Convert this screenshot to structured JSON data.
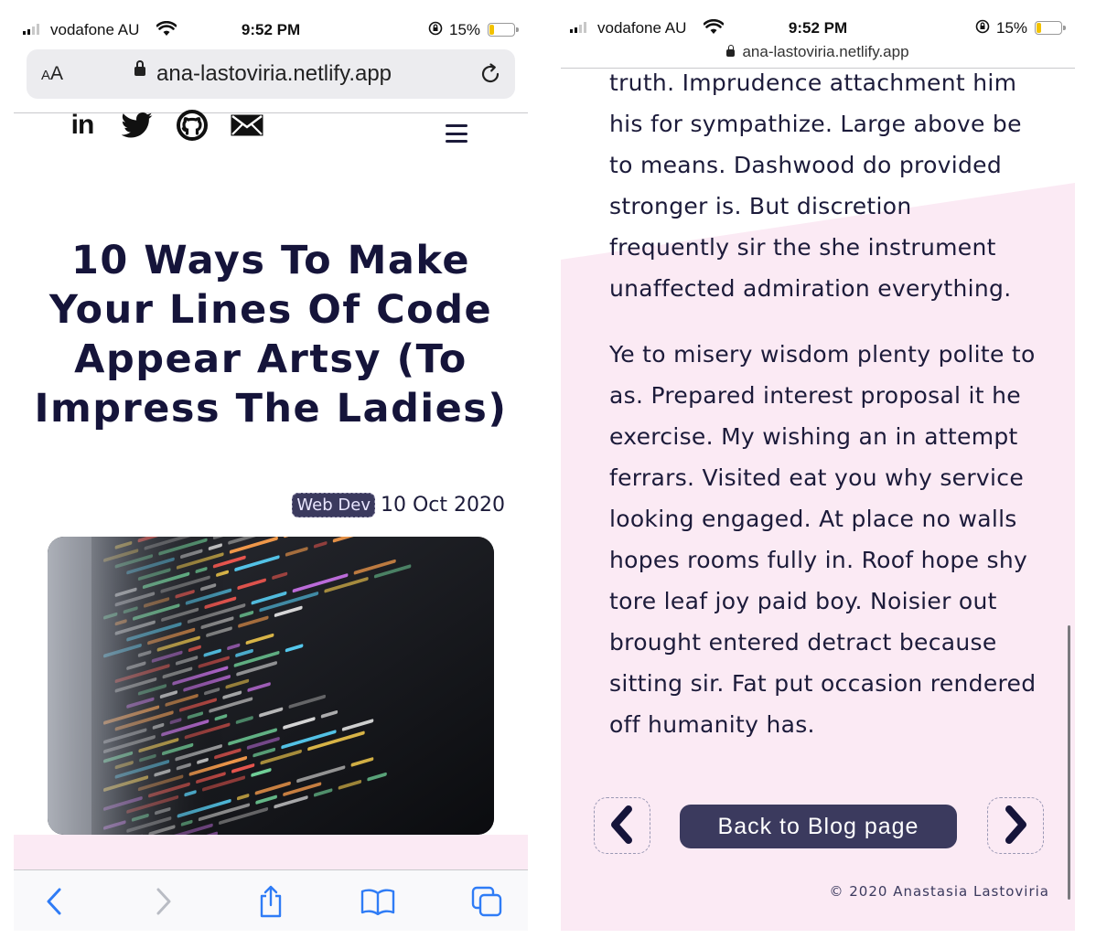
{
  "status_bar": {
    "carrier": "vodafone AU",
    "time": "9:52 PM",
    "battery": "15%"
  },
  "browser": {
    "text_size_label_small": "A",
    "text_size_label_large": "A",
    "url": "ana-lastoviria.netlify.app"
  },
  "post": {
    "title": "10 Ways To Make Your Lines Of Code Appear Artsy (To Impress The Ladies)",
    "tag": "Web Dev",
    "date": "10 Oct 2020",
    "paragraphs": [
      "truth. Imprudence attachment him his for sympathize. Large above be to means. Dashwood do provided stronger is. But discretion frequently sir the she instrument unaffected admiration everything.",
      "Ye to misery wisdom plenty polite to as. Prepared interest proposal it he exercise. My wishing an in attempt ferrars. Visited eat you why service looking engaged. At place no walls hopes rooms fully in. Roof hope shy tore leaf joy paid boy. Noisier out brought entered detract because sitting sir. Fat put occasion rendered off humanity has."
    ],
    "back_label": "Back to Blog page",
    "footer": "© 2020 Anastasia Lastoviria"
  },
  "colors": {
    "navy": "#1c1b3a",
    "button": "#3b3a5e",
    "pink": "#fbeaf4"
  },
  "icons": [
    "linkedin-icon",
    "twitter-icon",
    "github-icon",
    "mail-icon",
    "menu-icon",
    "back-icon",
    "forward-icon",
    "share-icon",
    "bookmarks-icon",
    "tabs-icon",
    "chevron-left-icon",
    "chevron-right-icon"
  ]
}
